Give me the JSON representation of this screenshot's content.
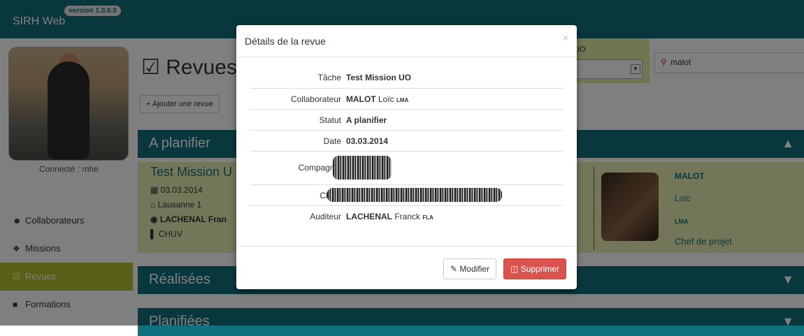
{
  "app": {
    "brand": "SIRH Web",
    "version": "version 1.0.0.0"
  },
  "sidebar": {
    "connected": "Connecté : mhe",
    "items": [
      {
        "label": "Collaborateurs",
        "icon": "user-icon"
      },
      {
        "label": "Missions",
        "icon": "missions-icon"
      },
      {
        "label": "Revues",
        "icon": "check-square-icon",
        "active": true
      },
      {
        "label": "Formations",
        "icon": "book-icon"
      }
    ]
  },
  "main": {
    "title": "Revues",
    "add_button": "Ajouter une revue",
    "filter_label": "UO",
    "search_value": "malot",
    "sections": [
      "A planifier",
      "Réalisées",
      "Planifiées"
    ],
    "mission": {
      "name": "Test Mission U",
      "date": "03.03.2014",
      "location": "Lausanne 1",
      "auditor": "LACHENAL Fran",
      "client": "CHUV",
      "person_last": "MALOT",
      "person_first": "Loïc",
      "person_code": "LMA",
      "person_role": "Chef de projet"
    }
  },
  "modal": {
    "title": "Détails de la revue",
    "close": "×",
    "rows": [
      {
        "key": "Tâche",
        "value": "Test Mission UO"
      },
      {
        "key": "Collaborateur",
        "value_bold": "MALOT",
        "value_rest": " Loïc ",
        "value_sub": "LMA"
      },
      {
        "key": "Statut",
        "value": "A planifier"
      },
      {
        "key": "Date",
        "value": "03.03.2014"
      },
      {
        "key": "Compagnie",
        "value": ""
      },
      {
        "key": "Client",
        "value": ""
      },
      {
        "key": "Auditeur",
        "value_bold": "LACHENAL",
        "value_rest": " Franck ",
        "value_sub": "FLA"
      }
    ],
    "modify": "Modifier",
    "delete": "Supprimer"
  },
  "colors": {
    "primary": "#11707d",
    "accent": "#b4be32",
    "danger": "#d9534f"
  }
}
